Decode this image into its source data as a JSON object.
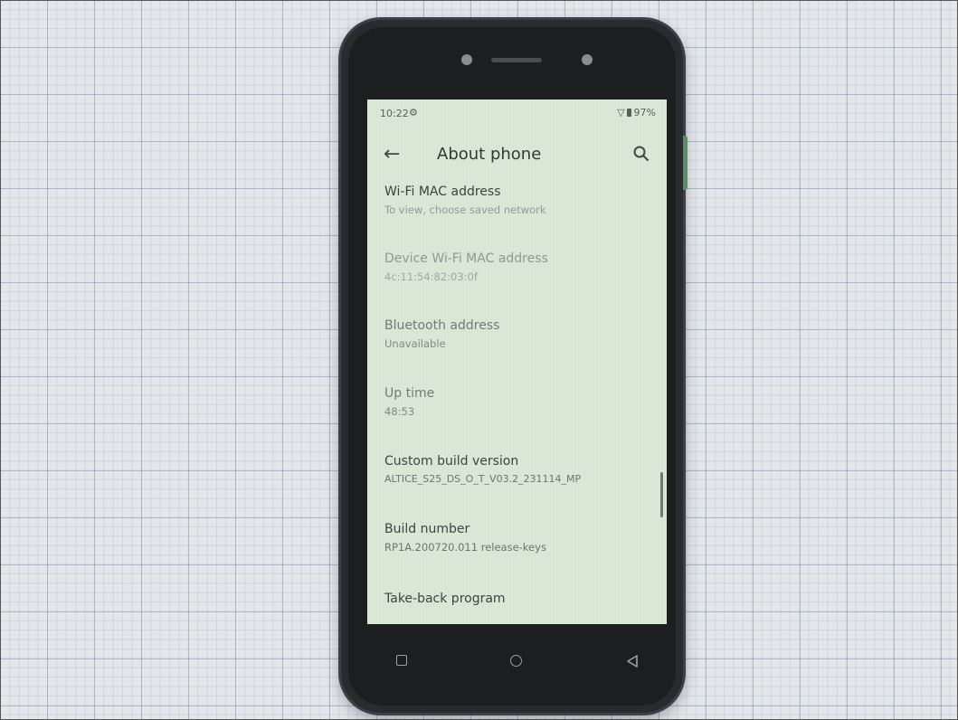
{
  "status_bar": {
    "time": "10:22",
    "battery": "97%"
  },
  "app_bar": {
    "title": "About phone",
    "back_icon": "arrow-back-icon",
    "search_icon": "search-icon"
  },
  "items": [
    {
      "title": "Wi-Fi MAC address",
      "value": "To view, choose saved network"
    },
    {
      "title": "Device Wi-Fi MAC address",
      "value": "4c:11:54:82:03:0f"
    },
    {
      "title": "Bluetooth address",
      "value": "Unavailable"
    },
    {
      "title": "Up time",
      "value": "48:53"
    },
    {
      "title": "Custom build version",
      "value": "ALTICE_S25_DS_O_T_V03.2_231114_MP"
    },
    {
      "title": "Build number",
      "value": "RP1A.200720.011 release-keys"
    },
    {
      "title": "Take-back program",
      "value": ""
    }
  ],
  "nav_bar": {
    "recents_icon": "square-icon",
    "home_icon": "circle-icon",
    "back_icon": "triangle-back-icon"
  },
  "colors": {
    "screen_bg": "#d8e6d4",
    "phone_body": "#2a2b2e",
    "text_primary": "#3a4640",
    "text_secondary": "#6a756f"
  }
}
